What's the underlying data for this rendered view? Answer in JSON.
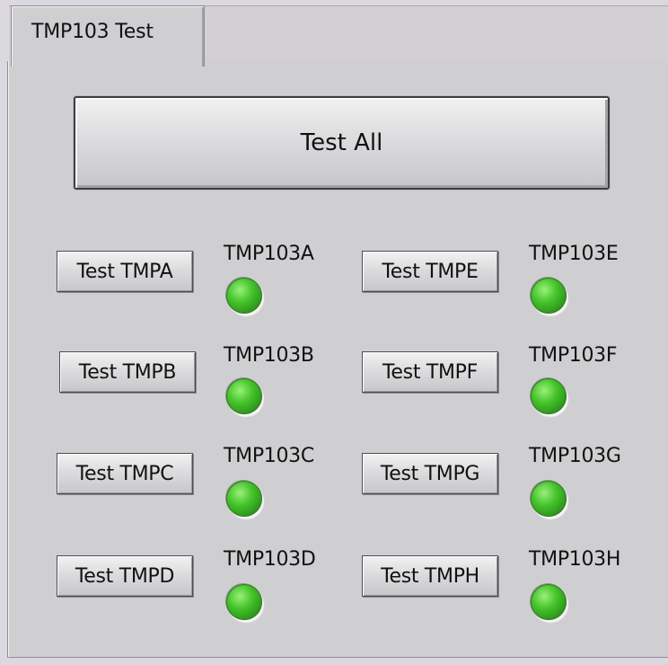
{
  "tab": {
    "label": "TMP103 Test"
  },
  "test_all": {
    "label": "Test All"
  },
  "left_column": [
    {
      "button_label": "Test TMPA",
      "indicator_label": "TMP103A",
      "indicator_color": "#45c42b"
    },
    {
      "button_label": "Test TMPB",
      "indicator_label": "TMP103B",
      "indicator_color": "#45c42b"
    },
    {
      "button_label": "Test TMPC",
      "indicator_label": "TMP103C",
      "indicator_color": "#45c42b"
    },
    {
      "button_label": "Test TMPD",
      "indicator_label": "TMP103D",
      "indicator_color": "#45c42b"
    }
  ],
  "right_column": [
    {
      "button_label": "Test TMPE",
      "indicator_label": "TMP103E",
      "indicator_color": "#45c42b"
    },
    {
      "button_label": "Test TMPF",
      "indicator_label": "TMP103F",
      "indicator_color": "#45c42b"
    },
    {
      "button_label": "Test TMPG",
      "indicator_label": "TMP103G",
      "indicator_color": "#45c42b"
    },
    {
      "button_label": "Test TMPH",
      "indicator_label": "TMP103H",
      "indicator_color": "#45c42b"
    }
  ]
}
